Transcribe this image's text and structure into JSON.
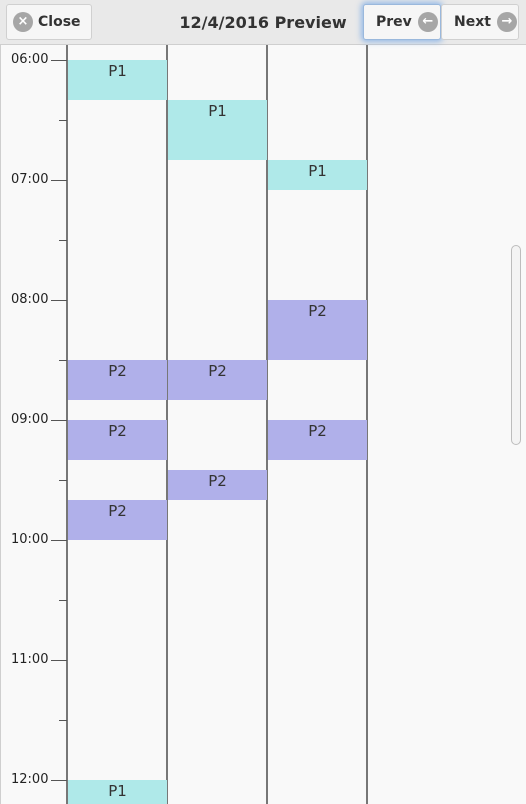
{
  "header": {
    "title": "12/4/2016 Preview",
    "close_label": "Close",
    "prev_label": "Prev",
    "next_label": "Next",
    "close_icon": "×",
    "prev_icon": "←",
    "next_icon": "→"
  },
  "times": [
    "06:00",
    "07:00",
    "08:00",
    "09:00",
    "10:00",
    "11:00",
    "12:00"
  ],
  "columns": [
    [
      {
        "label": "P1",
        "start": "06:00",
        "end": "06:20"
      },
      {
        "label": "P2",
        "start": "08:30",
        "end": "08:50"
      },
      {
        "label": "P2",
        "start": "09:00",
        "end": "09:20"
      },
      {
        "label": "P2",
        "start": "09:40",
        "end": "10:00"
      },
      {
        "label": "P1",
        "start": "12:00",
        "end": "12:20"
      }
    ],
    [
      {
        "label": "P1",
        "start": "06:20",
        "end": "06:50"
      },
      {
        "label": "P2",
        "start": "08:30",
        "end": "08:50"
      },
      {
        "label": "P2",
        "start": "09:25",
        "end": "09:40"
      }
    ],
    [
      {
        "label": "P1",
        "start": "06:50",
        "end": "07:05"
      },
      {
        "label": "P2",
        "start": "08:00",
        "end": "08:30"
      },
      {
        "label": "P2",
        "start": "09:00",
        "end": "09:20"
      }
    ],
    []
  ],
  "colors": {
    "P1": "#afe9e9",
    "P2": "#b0b0ea"
  }
}
